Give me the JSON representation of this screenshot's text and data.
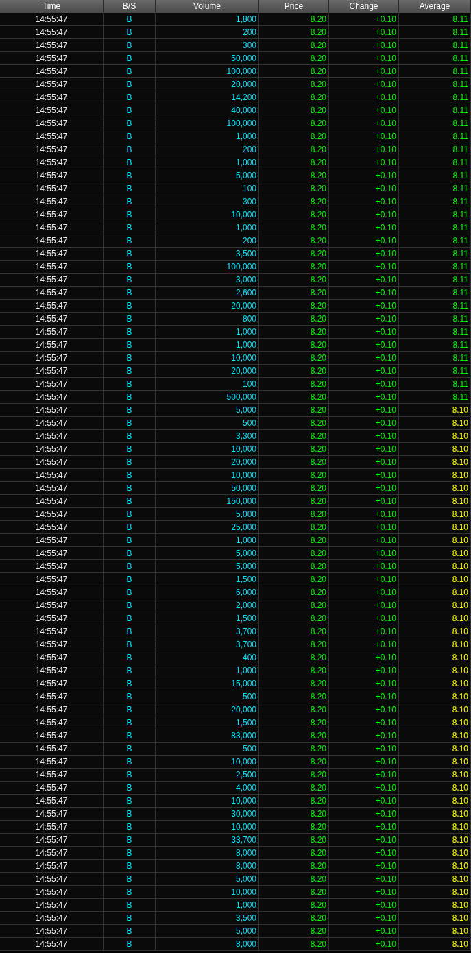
{
  "table": {
    "columns": [
      "Time",
      "B/S",
      "Volume",
      "Price",
      "Change",
      "Average"
    ],
    "rows": [
      {
        "time": "14:55:47",
        "side": "B",
        "volume": "1,800",
        "price": "8.20",
        "change": "+0.10",
        "average": "8.11",
        "color": "#00ff00"
      },
      {
        "time": "14:55:47",
        "side": "B",
        "volume": "200",
        "price": "8.20",
        "change": "+0.10",
        "average": "8.11",
        "color": "#00ff00"
      },
      {
        "time": "14:55:47",
        "side": "B",
        "volume": "300",
        "price": "8.20",
        "change": "+0.10",
        "average": "8.11",
        "color": "#00ff00"
      },
      {
        "time": "14:55:47",
        "side": "B",
        "volume": "50,000",
        "price": "8.20",
        "change": "+0.10",
        "average": "8.11",
        "color": "#00ff00"
      },
      {
        "time": "14:55:47",
        "side": "B",
        "volume": "100,000",
        "price": "8.20",
        "change": "+0.10",
        "average": "8.11",
        "color": "#00ff00"
      },
      {
        "time": "14:55:47",
        "side": "B",
        "volume": "20,000",
        "price": "8.20",
        "change": "+0.10",
        "average": "8.11",
        "color": "#00ff00"
      },
      {
        "time": "14:55:47",
        "side": "B",
        "volume": "14,200",
        "price": "8.20",
        "change": "+0.10",
        "average": "8.11",
        "color": "#00ff00"
      },
      {
        "time": "14:55:47",
        "side": "B",
        "volume": "40,000",
        "price": "8.20",
        "change": "+0.10",
        "average": "8.11",
        "color": "#00ff00"
      },
      {
        "time": "14:55:47",
        "side": "B",
        "volume": "100,000",
        "price": "8.20",
        "change": "+0.10",
        "average": "8.11",
        "color": "#00ff00"
      },
      {
        "time": "14:55:47",
        "side": "B",
        "volume": "1,000",
        "price": "8.20",
        "change": "+0.10",
        "average": "8.11",
        "color": "#00ff00"
      },
      {
        "time": "14:55:47",
        "side": "B",
        "volume": "200",
        "price": "8.20",
        "change": "+0.10",
        "average": "8.11",
        "color": "#00ff00"
      },
      {
        "time": "14:55:47",
        "side": "B",
        "volume": "1,000",
        "price": "8.20",
        "change": "+0.10",
        "average": "8.11",
        "color": "#00ff00"
      },
      {
        "time": "14:55:47",
        "side": "B",
        "volume": "5,000",
        "price": "8.20",
        "change": "+0.10",
        "average": "8.11",
        "color": "#00ff00"
      },
      {
        "time": "14:55:47",
        "side": "B",
        "volume": "100",
        "price": "8.20",
        "change": "+0.10",
        "average": "8.11",
        "color": "#00ff00"
      },
      {
        "time": "14:55:47",
        "side": "B",
        "volume": "300",
        "price": "8.20",
        "change": "+0.10",
        "average": "8.11",
        "color": "#00ff00"
      },
      {
        "time": "14:55:47",
        "side": "B",
        "volume": "10,000",
        "price": "8.20",
        "change": "+0.10",
        "average": "8.11",
        "color": "#00ff00"
      },
      {
        "time": "14:55:47",
        "side": "B",
        "volume": "1,000",
        "price": "8.20",
        "change": "+0.10",
        "average": "8.11",
        "color": "#00ff00"
      },
      {
        "time": "14:55:47",
        "side": "B",
        "volume": "200",
        "price": "8.20",
        "change": "+0.10",
        "average": "8.11",
        "color": "#00ff00"
      },
      {
        "time": "14:55:47",
        "side": "B",
        "volume": "3,500",
        "price": "8.20",
        "change": "+0.10",
        "average": "8.11",
        "color": "#00ff00"
      },
      {
        "time": "14:55:47",
        "side": "B",
        "volume": "100,000",
        "price": "8.20",
        "change": "+0.10",
        "average": "8.11",
        "color": "#00ff00"
      },
      {
        "time": "14:55:47",
        "side": "B",
        "volume": "3,000",
        "price": "8.20",
        "change": "+0.10",
        "average": "8.11",
        "color": "#00ff00"
      },
      {
        "time": "14:55:47",
        "side": "B",
        "volume": "2,600",
        "price": "8.20",
        "change": "+0.10",
        "average": "8.11",
        "color": "#00ff00"
      },
      {
        "time": "14:55:47",
        "side": "B",
        "volume": "20,000",
        "price": "8.20",
        "change": "+0.10",
        "average": "8.11",
        "color": "#00ff00"
      },
      {
        "time": "14:55:47",
        "side": "B",
        "volume": "800",
        "price": "8.20",
        "change": "+0.10",
        "average": "8.11",
        "color": "#00ff00"
      },
      {
        "time": "14:55:47",
        "side": "B",
        "volume": "1,000",
        "price": "8.20",
        "change": "+0.10",
        "average": "8.11",
        "color": "#00ff00"
      },
      {
        "time": "14:55:47",
        "side": "B",
        "volume": "1,000",
        "price": "8.20",
        "change": "+0.10",
        "average": "8.11",
        "color": "#00ff00"
      },
      {
        "time": "14:55:47",
        "side": "B",
        "volume": "10,000",
        "price": "8.20",
        "change": "+0.10",
        "average": "8.11",
        "color": "#00ff00"
      },
      {
        "time": "14:55:47",
        "side": "B",
        "volume": "20,000",
        "price": "8.20",
        "change": "+0.10",
        "average": "8.11",
        "color": "#00ff00"
      },
      {
        "time": "14:55:47",
        "side": "B",
        "volume": "100",
        "price": "8.20",
        "change": "+0.10",
        "average": "8.11",
        "color": "#00ff00"
      },
      {
        "time": "14:55:47",
        "side": "B",
        "volume": "500,000",
        "price": "8.20",
        "change": "+0.10",
        "average": "8.11",
        "color": "#00ff00"
      },
      {
        "time": "14:55:47",
        "side": "B",
        "volume": "5,000",
        "price": "8.20",
        "change": "+0.10",
        "average": "8.10",
        "color": "#ffff00"
      },
      {
        "time": "14:55:47",
        "side": "B",
        "volume": "500",
        "price": "8.20",
        "change": "+0.10",
        "average": "8.10",
        "color": "#ffff00"
      },
      {
        "time": "14:55:47",
        "side": "B",
        "volume": "3,300",
        "price": "8.20",
        "change": "+0.10",
        "average": "8.10",
        "color": "#ffff00"
      },
      {
        "time": "14:55:47",
        "side": "B",
        "volume": "10,000",
        "price": "8.20",
        "change": "+0.10",
        "average": "8.10",
        "color": "#ffff00"
      },
      {
        "time": "14:55:47",
        "side": "B",
        "volume": "20,000",
        "price": "8.20",
        "change": "+0.10",
        "average": "8.10",
        "color": "#ffff00"
      },
      {
        "time": "14:55:47",
        "side": "B",
        "volume": "10,000",
        "price": "8.20",
        "change": "+0.10",
        "average": "8.10",
        "color": "#ffff00"
      },
      {
        "time": "14:55:47",
        "side": "B",
        "volume": "50,000",
        "price": "8.20",
        "change": "+0.10",
        "average": "8.10",
        "color": "#ffff00"
      },
      {
        "time": "14:55:47",
        "side": "B",
        "volume": "150,000",
        "price": "8.20",
        "change": "+0.10",
        "average": "8.10",
        "color": "#ffff00"
      },
      {
        "time": "14:55:47",
        "side": "B",
        "volume": "5,000",
        "price": "8.20",
        "change": "+0.10",
        "average": "8.10",
        "color": "#ffff00"
      },
      {
        "time": "14:55:47",
        "side": "B",
        "volume": "25,000",
        "price": "8.20",
        "change": "+0.10",
        "average": "8.10",
        "color": "#ffff00"
      },
      {
        "time": "14:55:47",
        "side": "B",
        "volume": "1,000",
        "price": "8.20",
        "change": "+0.10",
        "average": "8.10",
        "color": "#ffff00"
      },
      {
        "time": "14:55:47",
        "side": "B",
        "volume": "5,000",
        "price": "8.20",
        "change": "+0.10",
        "average": "8.10",
        "color": "#ffff00"
      },
      {
        "time": "14:55:47",
        "side": "B",
        "volume": "5,000",
        "price": "8.20",
        "change": "+0.10",
        "average": "8.10",
        "color": "#ffff00"
      },
      {
        "time": "14:55:47",
        "side": "B",
        "volume": "1,500",
        "price": "8.20",
        "change": "+0.10",
        "average": "8.10",
        "color": "#ffff00"
      },
      {
        "time": "14:55:47",
        "side": "B",
        "volume": "6,000",
        "price": "8.20",
        "change": "+0.10",
        "average": "8.10",
        "color": "#ffff00"
      },
      {
        "time": "14:55:47",
        "side": "B",
        "volume": "2,000",
        "price": "8.20",
        "change": "+0.10",
        "average": "8.10",
        "color": "#ffff00"
      },
      {
        "time": "14:55:47",
        "side": "B",
        "volume": "1,500",
        "price": "8.20",
        "change": "+0.10",
        "average": "8.10",
        "color": "#ffff00"
      },
      {
        "time": "14:55:47",
        "side": "B",
        "volume": "3,700",
        "price": "8.20",
        "change": "+0.10",
        "average": "8.10",
        "color": "#ffff00"
      },
      {
        "time": "14:55:47",
        "side": "B",
        "volume": "3,700",
        "price": "8.20",
        "change": "+0.10",
        "average": "8.10",
        "color": "#ffff00"
      },
      {
        "time": "14:55:47",
        "side": "B",
        "volume": "400",
        "price": "8.20",
        "change": "+0.10",
        "average": "8.10",
        "color": "#ffff00"
      },
      {
        "time": "14:55:47",
        "side": "B",
        "volume": "1,000",
        "price": "8.20",
        "change": "+0.10",
        "average": "8.10",
        "color": "#ffff00"
      },
      {
        "time": "14:55:47",
        "side": "B",
        "volume": "15,000",
        "price": "8.20",
        "change": "+0.10",
        "average": "8.10",
        "color": "#ffff00"
      },
      {
        "time": "14:55:47",
        "side": "B",
        "volume": "500",
        "price": "8.20",
        "change": "+0.10",
        "average": "8.10",
        "color": "#ffff00"
      },
      {
        "time": "14:55:47",
        "side": "B",
        "volume": "20,000",
        "price": "8.20",
        "change": "+0.10",
        "average": "8.10",
        "color": "#ffff00"
      },
      {
        "time": "14:55:47",
        "side": "B",
        "volume": "1,500",
        "price": "8.20",
        "change": "+0.10",
        "average": "8.10",
        "color": "#ffff00"
      },
      {
        "time": "14:55:47",
        "side": "B",
        "volume": "83,000",
        "price": "8.20",
        "change": "+0.10",
        "average": "8.10",
        "color": "#ffff00"
      },
      {
        "time": "14:55:47",
        "side": "B",
        "volume": "500",
        "price": "8.20",
        "change": "+0.10",
        "average": "8.10",
        "color": "#ffff00"
      },
      {
        "time": "14:55:47",
        "side": "B",
        "volume": "10,000",
        "price": "8.20",
        "change": "+0.10",
        "average": "8.10",
        "color": "#ffff00"
      },
      {
        "time": "14:55:47",
        "side": "B",
        "volume": "2,500",
        "price": "8.20",
        "change": "+0.10",
        "average": "8.10",
        "color": "#ffff00"
      },
      {
        "time": "14:55:47",
        "side": "B",
        "volume": "4,000",
        "price": "8.20",
        "change": "+0.10",
        "average": "8.10",
        "color": "#ffff00"
      },
      {
        "time": "14:55:47",
        "side": "B",
        "volume": "10,000",
        "price": "8.20",
        "change": "+0.10",
        "average": "8.10",
        "color": "#ffff00"
      },
      {
        "time": "14:55:47",
        "side": "B",
        "volume": "30,000",
        "price": "8.20",
        "change": "+0.10",
        "average": "8.10",
        "color": "#ffff00"
      },
      {
        "time": "14:55:47",
        "side": "B",
        "volume": "10,000",
        "price": "8.20",
        "change": "+0.10",
        "average": "8.10",
        "color": "#ffff00"
      },
      {
        "time": "14:55:47",
        "side": "B",
        "volume": "33,700",
        "price": "8.20",
        "change": "+0.10",
        "average": "8.10",
        "color": "#ffff00"
      },
      {
        "time": "14:55:47",
        "side": "B",
        "volume": "8,000",
        "price": "8.20",
        "change": "+0.10",
        "average": "8.10",
        "color": "#ffff00"
      },
      {
        "time": "14:55:47",
        "side": "B",
        "volume": "8,000",
        "price": "8.20",
        "change": "+0.10",
        "average": "8.10",
        "color": "#ffff00"
      },
      {
        "time": "14:55:47",
        "side": "B",
        "volume": "5,000",
        "price": "8.20",
        "change": "+0.10",
        "average": "8.10",
        "color": "#ffff00"
      },
      {
        "time": "14:55:47",
        "side": "B",
        "volume": "10,000",
        "price": "8.20",
        "change": "+0.10",
        "average": "8.10",
        "color": "#ffff00"
      },
      {
        "time": "14:55:47",
        "side": "B",
        "volume": "1,000",
        "price": "8.20",
        "change": "+0.10",
        "average": "8.10",
        "color": "#ffff00"
      },
      {
        "time": "14:55:47",
        "side": "B",
        "volume": "3,500",
        "price": "8.20",
        "change": "+0.10",
        "average": "8.10",
        "color": "#ffff00"
      },
      {
        "time": "14:55:47",
        "side": "B",
        "volume": "5,000",
        "price": "8.20",
        "change": "+0.10",
        "average": "8.10",
        "color": "#ffff00"
      },
      {
        "time": "14:55:47",
        "side": "B",
        "volume": "8,000",
        "price": "8.20",
        "change": "+0.10",
        "average": "8.10",
        "color": "#ffff00"
      }
    ]
  }
}
